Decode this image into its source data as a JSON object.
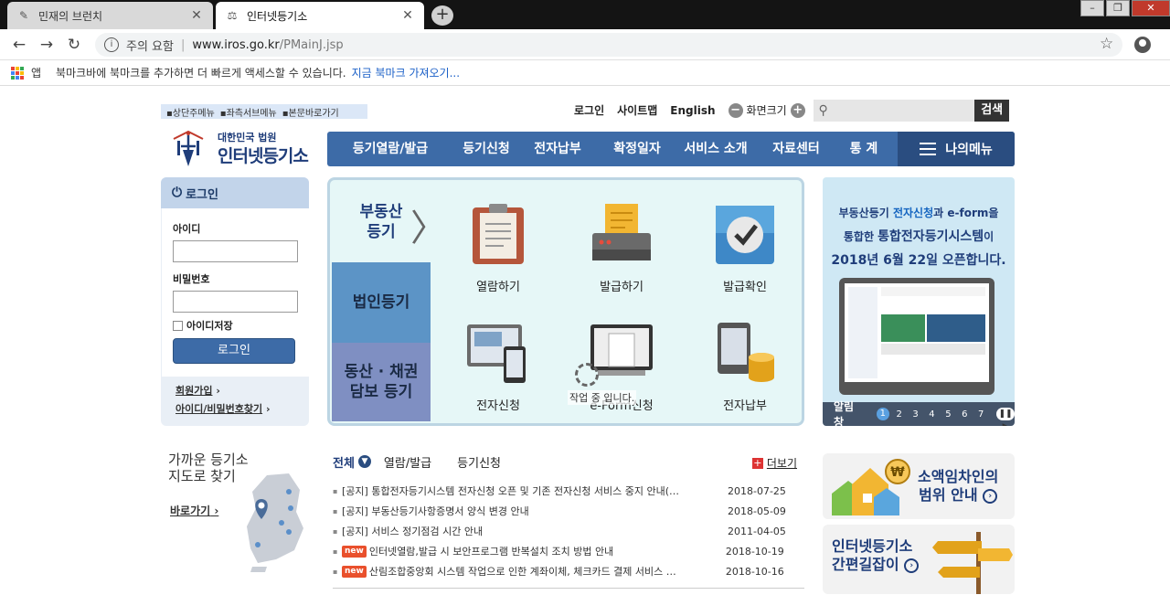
{
  "browser": {
    "tabs": [
      {
        "title": "민재의 브런치",
        "active": false
      },
      {
        "title": "인터넷등기소",
        "active": true
      }
    ],
    "address": {
      "security_label": "주의 요함",
      "host": "www.iros.go.kr",
      "path": "/PMainJ.jsp"
    },
    "bookmarks": {
      "apps_label": "앱",
      "hint": "북마크바에 북마크를 추가하면 더 빠르게 액세스할 수 있습니다.",
      "import_link": "지금 북마크 가져오기..."
    }
  },
  "site": {
    "skip_links": [
      "상단주메뉴",
      "좌측서브메뉴",
      "본문바로가기"
    ],
    "top_links": {
      "login": "로그인",
      "sitemap": "사이트맵",
      "english": "English",
      "zoom": "화면크기",
      "zoom_minus": "−",
      "zoom_plus": "+"
    },
    "search": {
      "button": "검색",
      "placeholder": ""
    },
    "logo": {
      "org": "대한민국 법원",
      "name": "인터넷등기소"
    },
    "gnb": [
      "등기열람/발급",
      "등기신청",
      "전자납부",
      "확정일자",
      "서비스 소개",
      "자료센터",
      "통 계"
    ],
    "my_menu": "나의메뉴",
    "login_box": {
      "title": "로그인",
      "id_label": "아이디",
      "pw_label": "비밀번호",
      "save_id": "아이디저장",
      "button": "로그인",
      "join": "회원가입",
      "find": "아이디/비밀번호찾기"
    },
    "service": {
      "side_tabs": [
        "부동산\n등기",
        "법인등기",
        "동산 · 채권\n담보 등기"
      ],
      "items": [
        {
          "label": "열람하기",
          "icon": "clipboard-icon"
        },
        {
          "label": "발급하기",
          "icon": "printer-icon"
        },
        {
          "label": "발급확인",
          "icon": "checkmark-icon"
        },
        {
          "label": "전자신청",
          "icon": "monitor-phone-icon"
        },
        {
          "label": "e-Form신청",
          "icon": "document-screen-icon"
        },
        {
          "label": "전자납부",
          "icon": "coins-icon"
        }
      ],
      "loading_text": "작업 중 입니다."
    },
    "banner": {
      "line1a": "부동산등기 ",
      "line1b": "전자신청",
      "line1c": "과 e-form을",
      "line2a": "통합한 ",
      "line2b": "통합전자등기시스템",
      "line2c": "이",
      "line3": "2018년 6월 22일 오픈합니다.",
      "bar_label": "알림창",
      "pages": [
        "1",
        "2",
        "3",
        "4",
        "5",
        "6",
        "7"
      ],
      "pause": "❚❚ ▶"
    },
    "nearby": {
      "title1": "가까운 등기소",
      "title2": "지도로 찾기",
      "link": "바로가기"
    },
    "notices": {
      "tabs": [
        "전체",
        "열람/발급",
        "등기신청"
      ],
      "more": "더보기",
      "items": [
        {
          "new": false,
          "title": "[공지] 통합전자등기시스템 전자신청 오픈 및 기존 전자신청 서비스 중지 안내(…",
          "date": "2018-07-25"
        },
        {
          "new": false,
          "title": "[공지] 부동산등기사항증명서 양식 변경 안내",
          "date": "2018-05-09"
        },
        {
          "new": false,
          "title": "[공지] 서비스 정기점검 시간 안내",
          "date": "2011-04-05"
        },
        {
          "new": true,
          "title": "인터넷열람,발급 시 보안프로그램 반복설치 조치 방법 안내",
          "date": "2018-10-19"
        },
        {
          "new": true,
          "title": "산림조합중앙회 시스템 작업으로 인한 계좌이체, 체크카드 결제 서비스 …",
          "date": "2018-10-16"
        }
      ],
      "new_badge": "new"
    },
    "promos": {
      "p1a": "소액임차인의",
      "p1b": "범위 안내",
      "p2a": "인터넷등기소",
      "p2b": "간편길잡이"
    }
  }
}
